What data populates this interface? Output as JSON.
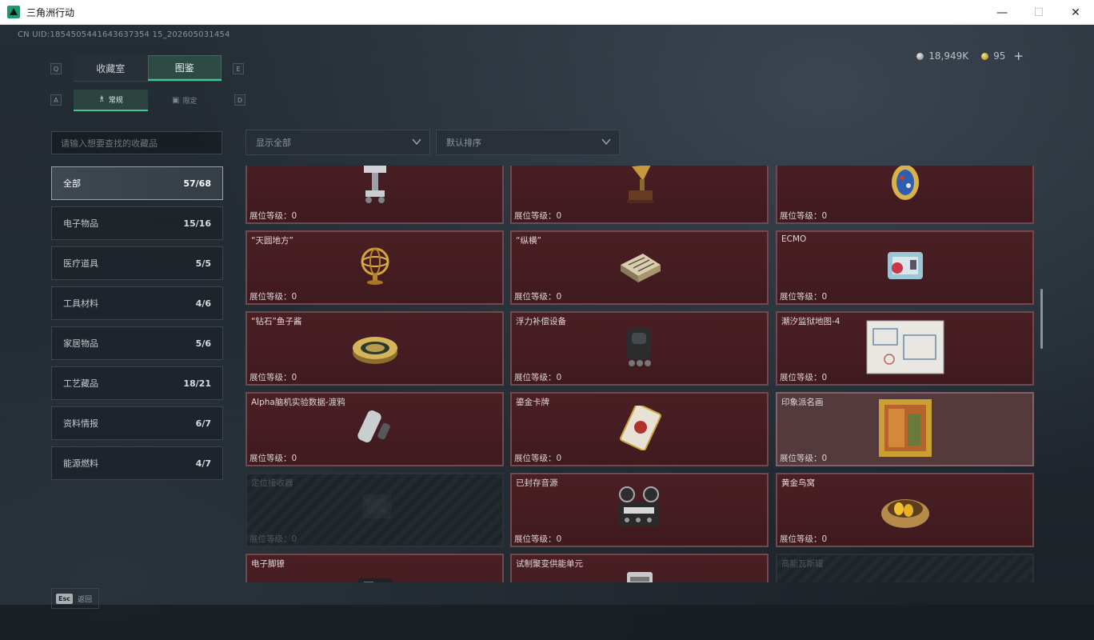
{
  "window": {
    "title": "三角洲行动",
    "minimize": "—",
    "maximize": "☐",
    "close": "✕"
  },
  "header": {
    "uid": "CN UID:1854505441643637354 15_202605031454",
    "silver": "18,949K",
    "gold": "95",
    "plus": "+"
  },
  "tabs": {
    "key_left": "Q",
    "key_right": "E",
    "items": [
      {
        "label": "收藏室"
      },
      {
        "label": "图鉴"
      }
    ],
    "active": "图鉴"
  },
  "subtabs": {
    "key_left": "A",
    "key_right": "D",
    "items": [
      {
        "label": "常规",
        "icon": "trophy-icon"
      },
      {
        "label": "限定",
        "icon": "box-icon"
      }
    ],
    "active": "常规"
  },
  "search": {
    "placeholder": "请输入想要查找的收藏品"
  },
  "filters": {
    "show": "显示全部",
    "sort": "默认排序"
  },
  "categories": [
    {
      "label": "全部",
      "count": "57/68"
    },
    {
      "label": "电子物品",
      "count": "15/16"
    },
    {
      "label": "医疗道具",
      "count": "5/5"
    },
    {
      "label": "工具材料",
      "count": "4/6"
    },
    {
      "label": "家居物品",
      "count": "5/6"
    },
    {
      "label": "工艺藏品",
      "count": "18/21"
    },
    {
      "label": "资料情报",
      "count": "6/7"
    },
    {
      "label": "能源燃料",
      "count": "4/7"
    }
  ],
  "level_label": "展位等级：0",
  "items": [
    {
      "name": "",
      "art": "robot-arm"
    },
    {
      "name": "",
      "art": "gramophone"
    },
    {
      "name": "",
      "art": "jeweled-egg"
    },
    {
      "name": "“天圆地方”",
      "art": "armillary-sphere"
    },
    {
      "name": "“纵横”",
      "art": "chess-box"
    },
    {
      "name": "ECMO",
      "art": "ecmo-machine"
    },
    {
      "name": "“钻石”鱼子酱",
      "art": "caviar-tin"
    },
    {
      "name": "浮力补偿设备",
      "art": "bcd-vest"
    },
    {
      "name": "潮汐监狱地图-4",
      "art": "prison-map"
    },
    {
      "name": "Alpha脑机实验数据-渡鸦",
      "art": "data-canister"
    },
    {
      "name": "鎏金卡牌",
      "art": "gilded-card"
    },
    {
      "name": "印象派名画",
      "art": "framed-painting"
    },
    {
      "name": "定位接收器",
      "art": "locator"
    },
    {
      "name": "已封存音源",
      "art": "tape-recorder"
    },
    {
      "name": "黄金鸟窝",
      "art": "golden-nest"
    },
    {
      "name": "电子脚镣",
      "art": "ankle-monitor"
    },
    {
      "name": "试制聚变供能单元",
      "art": "fusion-cell"
    },
    {
      "name": "高能瓦斯罐",
      "art": "gas-canister"
    }
  ],
  "footer": {
    "esc_key": "Esc",
    "back": "返回"
  }
}
